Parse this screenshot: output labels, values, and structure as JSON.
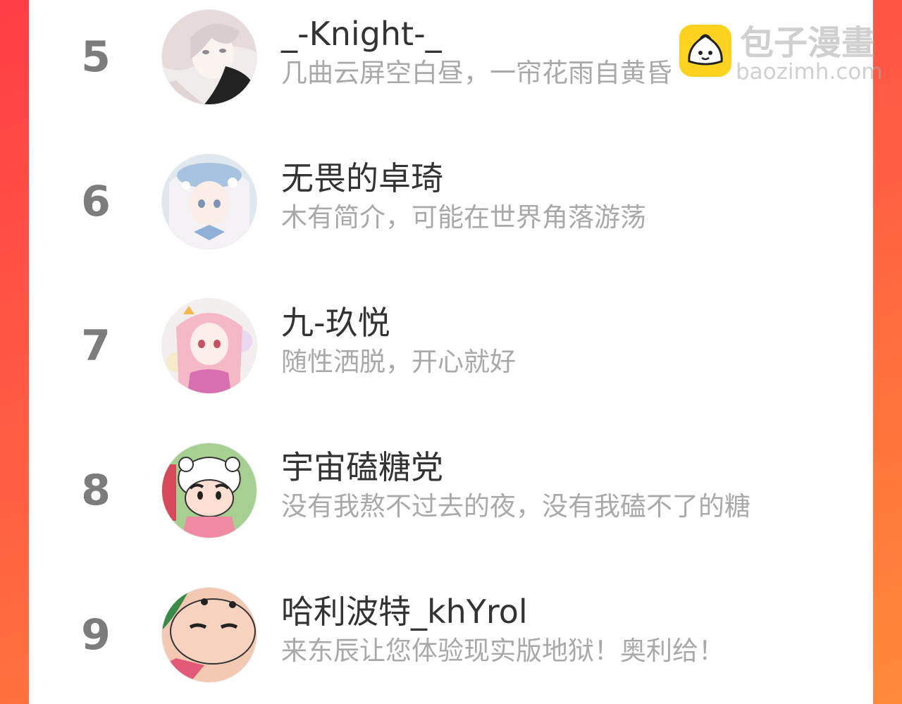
{
  "list": {
    "items": [
      {
        "rank": "5",
        "name": "_-Knight-_",
        "bio": "几曲云屏空白昼，一帘花雨自黄昏",
        "avatar_icon": "anime-portrait-avatar-icon"
      },
      {
        "rank": "6",
        "name": "无畏的卓琦",
        "bio": "木有简介，可能在世界角落游荡",
        "avatar_icon": "anime-girl-blue-avatar-icon"
      },
      {
        "rank": "7",
        "name": "九-玖悦",
        "bio": "随性洒脱，开心就好",
        "avatar_icon": "anime-girl-pink-avatar-icon"
      },
      {
        "rank": "8",
        "name": "宇宙磕糖党",
        "bio": "没有我熬不过去的夜，没有我磕不了的糖",
        "avatar_icon": "cartoon-bear-hat-avatar-icon"
      },
      {
        "rank": "9",
        "name": "哈利波特_khYrol",
        "bio": "来东辰让您体验现实版地狱！奥利给！",
        "avatar_icon": "cartoon-face-avatar-icon"
      }
    ]
  },
  "watermark": {
    "title": "包子漫畫",
    "url": "baozimh.com",
    "logo_icon": "bun-logo-icon"
  },
  "colors": {
    "background_gradient_start": "#ff3e45",
    "background_gradient_end": "#ff8a3a",
    "rank": "#7c7c7c",
    "name": "#333333",
    "bio": "#a9a9a9",
    "logo": "#ffd21f"
  }
}
